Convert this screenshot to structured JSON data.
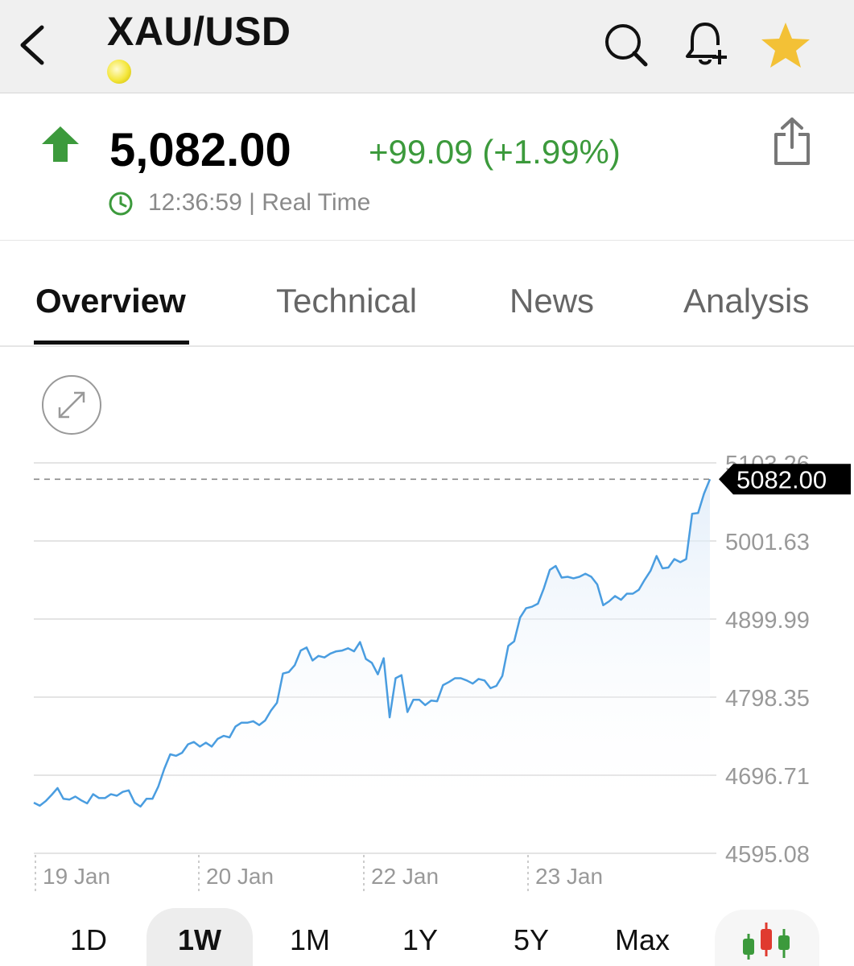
{
  "header": {
    "title": "XAU/USD",
    "icons": [
      "back-icon",
      "gold-coin-icon",
      "search-icon",
      "bell-plus-icon",
      "star-icon"
    ],
    "star_color": "#f3c136"
  },
  "quote": {
    "price": "5,082.00",
    "change": "+99.09 (+1.99%)",
    "time": "12:36:59 | Real Time",
    "up_color": "#3c9a3c"
  },
  "tabs": {
    "items": [
      {
        "label": "Overview",
        "active": true
      },
      {
        "label": "Technical",
        "active": false
      },
      {
        "label": "News",
        "active": false
      },
      {
        "label": "Analysis",
        "active": false
      }
    ]
  },
  "ranges": {
    "items": [
      {
        "label": "1D",
        "active": false
      },
      {
        "label": "1W",
        "active": true
      },
      {
        "label": "1M",
        "active": false
      },
      {
        "label": "1Y",
        "active": false
      },
      {
        "label": "5Y",
        "active": false
      },
      {
        "label": "Max",
        "active": false
      }
    ]
  },
  "chart_data": {
    "type": "area",
    "current_price_label": "5082.00",
    "y_ticks": [
      "5103.26",
      "5001.63",
      "4899.99",
      "4798.35",
      "4696.71",
      "4595.08"
    ],
    "ylim": [
      4595.08,
      5103.26
    ],
    "x_ticks": [
      "19 Jan",
      "20 Jan",
      "22 Jan",
      "23 Jan"
    ],
    "grid": true,
    "line_color": "#4a9de0",
    "values": [
      4661,
      4657,
      4663,
      4671,
      4680,
      4666,
      4665,
      4669,
      4664,
      4660,
      4672,
      4667,
      4667,
      4672,
      4670,
      4675,
      4677,
      4661,
      4656,
      4666,
      4666,
      4682,
      4705,
      4724,
      4722,
      4726,
      4737,
      4740,
      4734,
      4739,
      4734,
      4744,
      4748,
      4746,
      4760,
      4765,
      4765,
      4767,
      4762,
      4768,
      4781,
      4791,
      4829,
      4831,
      4840,
      4859,
      4863,
      4846,
      4852,
      4850,
      4855,
      4858,
      4859,
      4862,
      4858,
      4870,
      4848,
      4843,
      4828,
      4849,
      4772,
      4823,
      4827,
      4779,
      4795,
      4795,
      4788,
      4794,
      4793,
      4814,
      4818,
      4823,
      4823,
      4820,
      4816,
      4822,
      4820,
      4810,
      4813,
      4826,
      4865,
      4871,
      4902,
      4914,
      4916,
      4920,
      4940,
      4964,
      4969,
      4954,
      4955,
      4953,
      4955,
      4959,
      4955,
      4945,
      4918,
      4923,
      4930,
      4925,
      4933,
      4933,
      4938,
      4951,
      4963,
      4982,
      4966,
      4967,
      4978,
      4974,
      4978,
      5037,
      5038,
      5063,
      5082
    ]
  }
}
